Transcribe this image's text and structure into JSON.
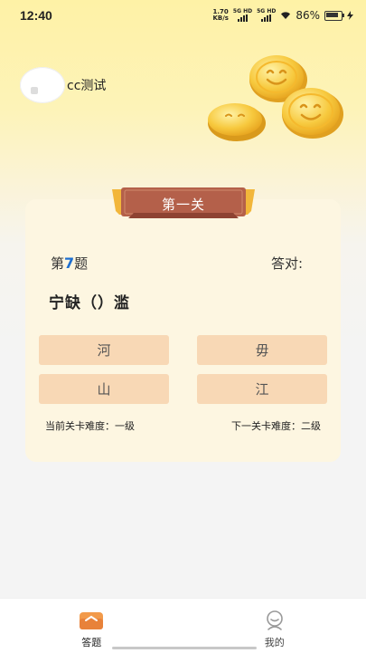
{
  "status_bar": {
    "time": "12:40",
    "net_speed_value": "1.70",
    "net_speed_unit": "KB/s",
    "sim1": "5G HD",
    "sim2": "5G HD",
    "battery": "86%"
  },
  "profile": {
    "username": "cc测试"
  },
  "level": {
    "title": "第一关"
  },
  "question": {
    "prefix": "第",
    "number": "7",
    "suffix": "题",
    "correct_label": "答对:",
    "idiom": "宁缺（）滥"
  },
  "options": [
    "河",
    "毋",
    "山",
    "江"
  ],
  "difficulty": {
    "current": "当前关卡难度：一级",
    "next": "下一关卡难度：二级"
  },
  "tabs": [
    {
      "label": "答题",
      "icon": "quiz-icon",
      "active": true
    },
    {
      "label": "我的",
      "icon": "profile-icon",
      "active": false
    }
  ],
  "colors": {
    "accent_blue": "#1e6fd0",
    "ribbon": "#b4604a",
    "option_bg": "#f8d8b5",
    "card_bg": "#fdf6e1"
  }
}
